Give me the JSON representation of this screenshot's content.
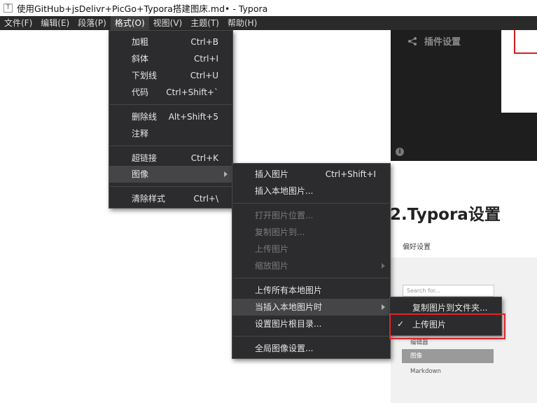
{
  "window": {
    "title": "使用GitHub+jsDelivr+PicGo+Typora搭建图床.md• - Typora",
    "app_icon": "T"
  },
  "menubar": [
    {
      "label": "文件(F)"
    },
    {
      "label": "编辑(E)"
    },
    {
      "label": "段落(P)"
    },
    {
      "label": "格式(O)"
    },
    {
      "label": "视图(V)"
    },
    {
      "label": "主题(T)"
    },
    {
      "label": "帮助(H)"
    }
  ],
  "format_menu": {
    "items": [
      {
        "label": "加粗",
        "shortcut": "Ctrl+B"
      },
      {
        "label": "斜体",
        "shortcut": "Ctrl+I"
      },
      {
        "label": "下划线",
        "shortcut": "Ctrl+U"
      },
      {
        "label": "代码",
        "shortcut": "Ctrl+Shift+`"
      },
      {
        "label": "删除线",
        "shortcut": "Alt+Shift+5"
      },
      {
        "label": "注释",
        "shortcut": ""
      },
      {
        "label": "超链接",
        "shortcut": "Ctrl+K"
      },
      {
        "label": "图像",
        "shortcut": ""
      },
      {
        "label": "清除样式",
        "shortcut": "Ctrl+\\"
      }
    ]
  },
  "image_menu": {
    "items": [
      {
        "label": "插入图片",
        "shortcut": "Ctrl+Shift+I"
      },
      {
        "label": "插入本地图片...",
        "shortcut": ""
      },
      {
        "label": "打开图片位置...",
        "shortcut": ""
      },
      {
        "label": "复制图片到...",
        "shortcut": ""
      },
      {
        "label": "上传图片",
        "shortcut": ""
      },
      {
        "label": "缩放图片",
        "shortcut": ""
      },
      {
        "label": "上传所有本地图片",
        "shortcut": ""
      },
      {
        "label": "当插入本地图片时",
        "shortcut": ""
      },
      {
        "label": "设置图片根目录...",
        "shortcut": ""
      },
      {
        "label": "全局图像设置...",
        "shortcut": ""
      }
    ]
  },
  "insert_menu": {
    "items": [
      {
        "label": "复制图片到文件夹...",
        "checked": false
      },
      {
        "label": "上传图片",
        "checked": true
      }
    ]
  },
  "document": {
    "heading": "2.Typora设置",
    "screenshot_top": {
      "plugin_label": "插件设置",
      "info_icon": "i"
    },
    "preferences": {
      "label": "偏好设置",
      "search_placeholder": "Search for...",
      "items": [
        "编辑器",
        "图像",
        "Markdown"
      ]
    }
  },
  "colors": {
    "menu_bg": "#2c2c2e",
    "highlight": "#454547",
    "annotation_red": "#e0242a",
    "menubar_bg": "#2a2a2a"
  }
}
